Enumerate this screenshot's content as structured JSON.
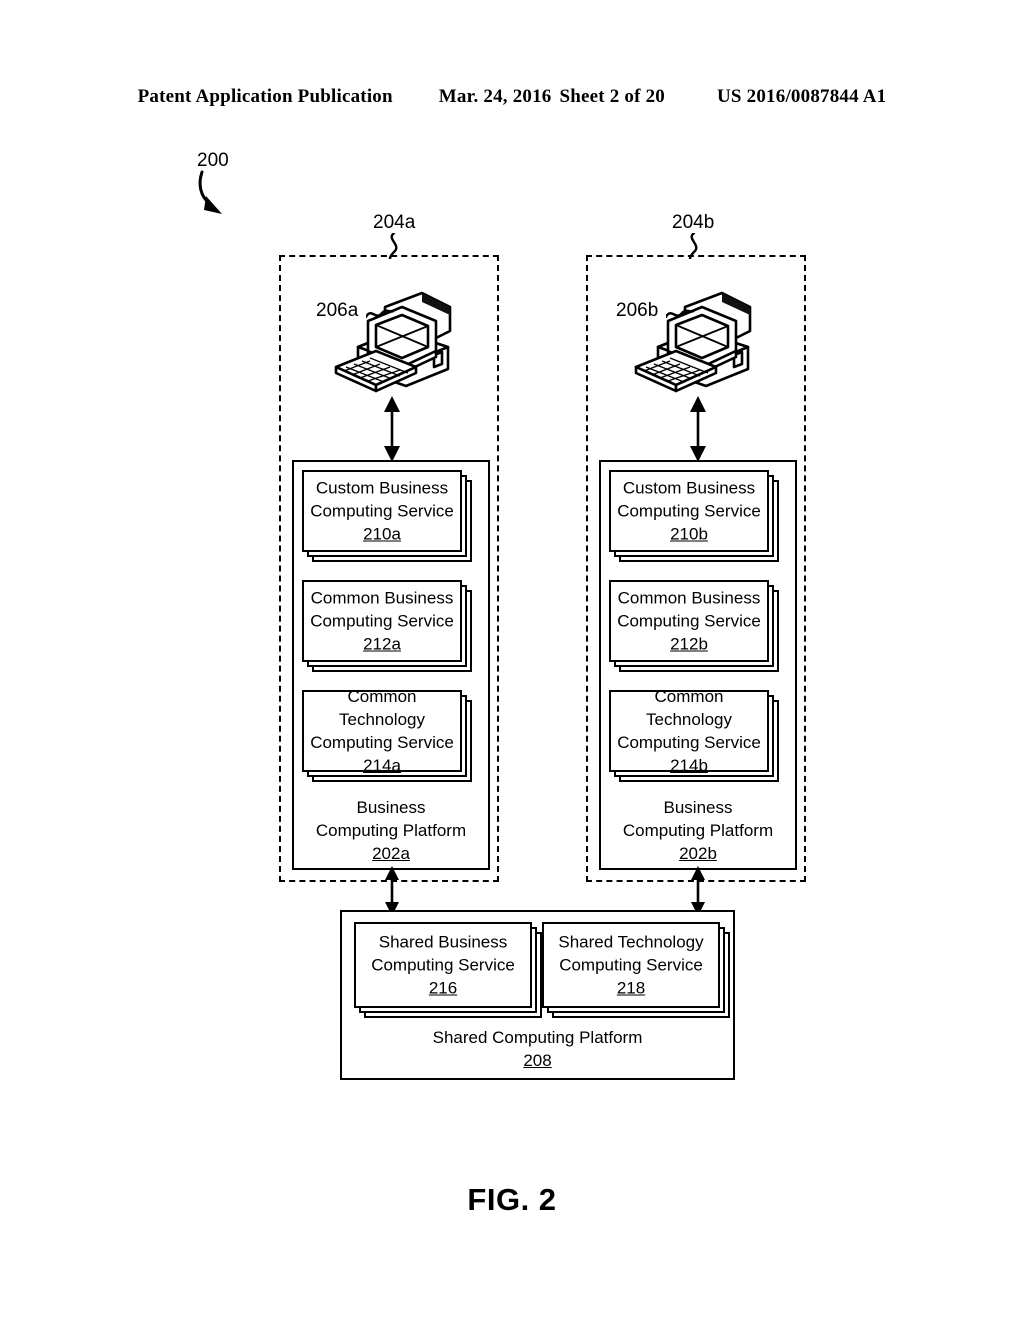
{
  "header": {
    "publication": "Patent Application Publication",
    "date": "Mar. 24, 2016",
    "sheet": "Sheet 2 of 20",
    "number": "US 2016/0087844 A1"
  },
  "figure": {
    "caption": "FIG. 2",
    "diagram_number": "200"
  },
  "domains": [
    {
      "ref": "204a",
      "computer": {
        "ref": "206a",
        "icon": "desktop-computer-icon"
      },
      "platform": {
        "title_line1": "Business",
        "title_line2": "Computing Platform",
        "ref": "202a"
      },
      "services": [
        {
          "line1": "Custom Business",
          "line2": "Computing Service",
          "ref": "210a"
        },
        {
          "line1": "Common Business",
          "line2": "Computing Service",
          "ref": "212a"
        },
        {
          "line1": "Common Technology",
          "line2": "Computing Service",
          "ref": "214a"
        }
      ]
    },
    {
      "ref": "204b",
      "computer": {
        "ref": "206b",
        "icon": "desktop-computer-icon"
      },
      "platform": {
        "title_line1": "Business",
        "title_line2": "Computing Platform",
        "ref": "202b"
      },
      "services": [
        {
          "line1": "Custom Business",
          "line2": "Computing Service",
          "ref": "210b"
        },
        {
          "line1": "Common Business",
          "line2": "Computing Service",
          "ref": "212b"
        },
        {
          "line1": "Common Technology",
          "line2": "Computing Service",
          "ref": "214b"
        }
      ]
    }
  ],
  "shared_platform": {
    "title": "Shared Computing Platform",
    "ref": "208",
    "services": [
      {
        "line1": "Shared Business",
        "line2": "Computing Service",
        "ref": "216"
      },
      {
        "line1": "Shared Technology",
        "line2": "Computing Service",
        "ref": "218"
      }
    ]
  },
  "colors": {
    "ink": "#000000",
    "paper": "#ffffff"
  }
}
